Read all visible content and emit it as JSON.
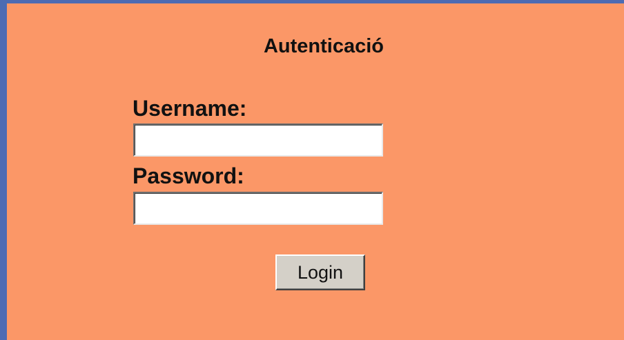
{
  "form": {
    "title": "Autenticació",
    "username_label": "Username:",
    "username_value": "",
    "password_label": "Password:",
    "password_value": "",
    "login_label": "Login"
  },
  "colors": {
    "frame": "#4d6bb3",
    "panel": "#fb9767",
    "button": "#d4d0c8"
  }
}
